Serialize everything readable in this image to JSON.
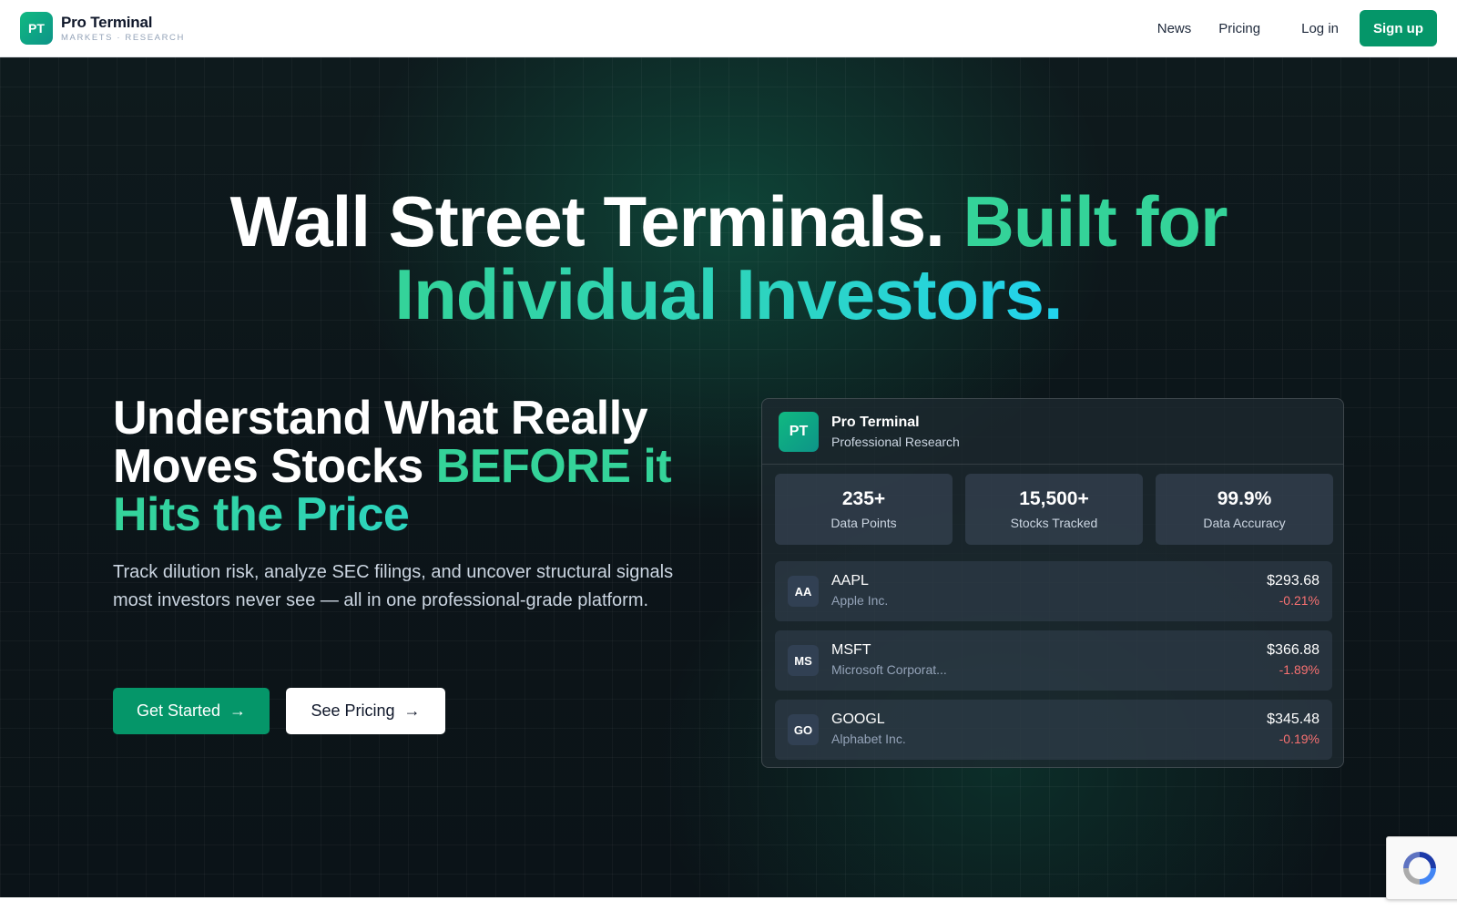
{
  "nav": {
    "logo_initials": "PT",
    "brand_name": "Pro Terminal",
    "brand_tagline": "MARKETS · RESEARCH",
    "links": [
      "News",
      "Pricing"
    ],
    "login": "Log in",
    "signup": "Sign up"
  },
  "hero": {
    "headline_white": "Wall Street Terminals.",
    "headline_green": "Built for",
    "headline_line2": "Individual Investors.",
    "subheading_white": "Understand What Really Moves Stocks",
    "subheading_accent": "BEFORE it",
    "subheading_accent2": "Hits the Price",
    "description": "Track dilution risk, analyze SEC filings, and uncover structural signals most investors never see — all in one professional-grade platform.",
    "primary_button": "Get Started",
    "secondary_button": "See Pricing",
    "arrow": "→"
  },
  "card": {
    "logo_initials": "PT",
    "title": "Pro Terminal",
    "subtitle": "Professional Research",
    "stats": [
      {
        "value": "235+",
        "label": "Data Points"
      },
      {
        "value": "15,500+",
        "label": "Stocks Tracked"
      },
      {
        "value": "99.9%",
        "label": "Data Accuracy"
      }
    ],
    "stocks": [
      {
        "abbr": "AA",
        "ticker": "AAPL",
        "company": "Apple Inc.",
        "price": "$293.68",
        "change": "-0.21%"
      },
      {
        "abbr": "MS",
        "ticker": "MSFT",
        "company": "Microsoft Corporat...",
        "price": "$366.88",
        "change": "-1.89%"
      },
      {
        "abbr": "GO",
        "ticker": "GOOGL",
        "company": "Alphabet Inc.",
        "price": "$345.48",
        "change": "-0.19%"
      }
    ]
  },
  "colors": {
    "brand_green": "#059669",
    "accent_green": "#34d399",
    "accent_cyan": "#22d3ee",
    "negative_red": "#f87171"
  }
}
